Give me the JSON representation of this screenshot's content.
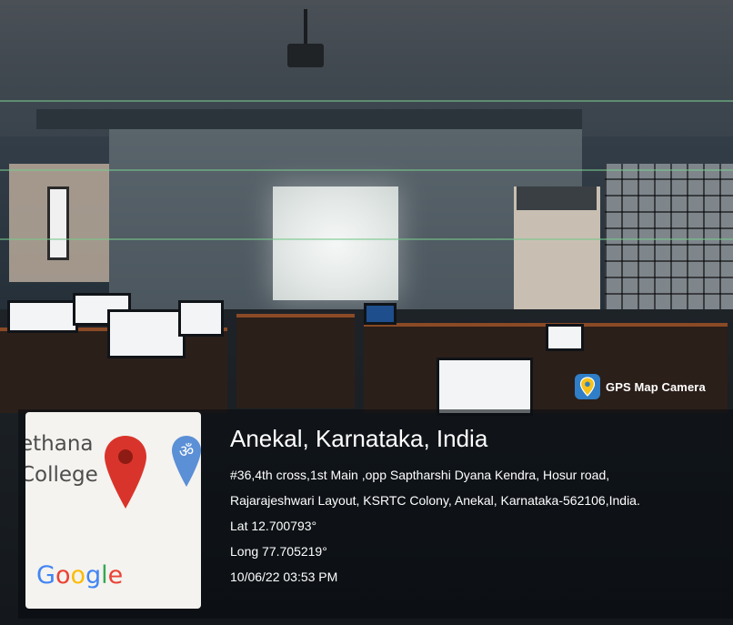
{
  "app": {
    "badge_label": "GPS Map Camera",
    "badge_icon": "map-pin-icon"
  },
  "map": {
    "text_line1": "ethana",
    "text_line2": "College",
    "brand_letters": [
      "G",
      "o",
      "o",
      "g",
      "l",
      "e"
    ],
    "pin_icon": "location-pin-icon",
    "poi_icon": "om-symbol-pin-icon",
    "poi_symbol": "ॐ"
  },
  "location": {
    "place": "Anekal, Karnataka, India",
    "address_line1": "#36,4th cross,1st Main ,opp Saptharshi Dyana Kendra, Hosur road,",
    "address_line2": "Rajarajeshwari Layout, KSRTC Colony, Anekal, Karnataka-562106,India.",
    "lat": "Lat 12.700793°",
    "long": "Long 77.705219°",
    "timestamp": "10/06/22 03:53 PM"
  },
  "colors": {
    "pin_red": "#d9342b",
    "poi_blue": "#5b8fd6",
    "badge_blue": "#2f7ec7",
    "desk_edge": "#8a4a26"
  }
}
